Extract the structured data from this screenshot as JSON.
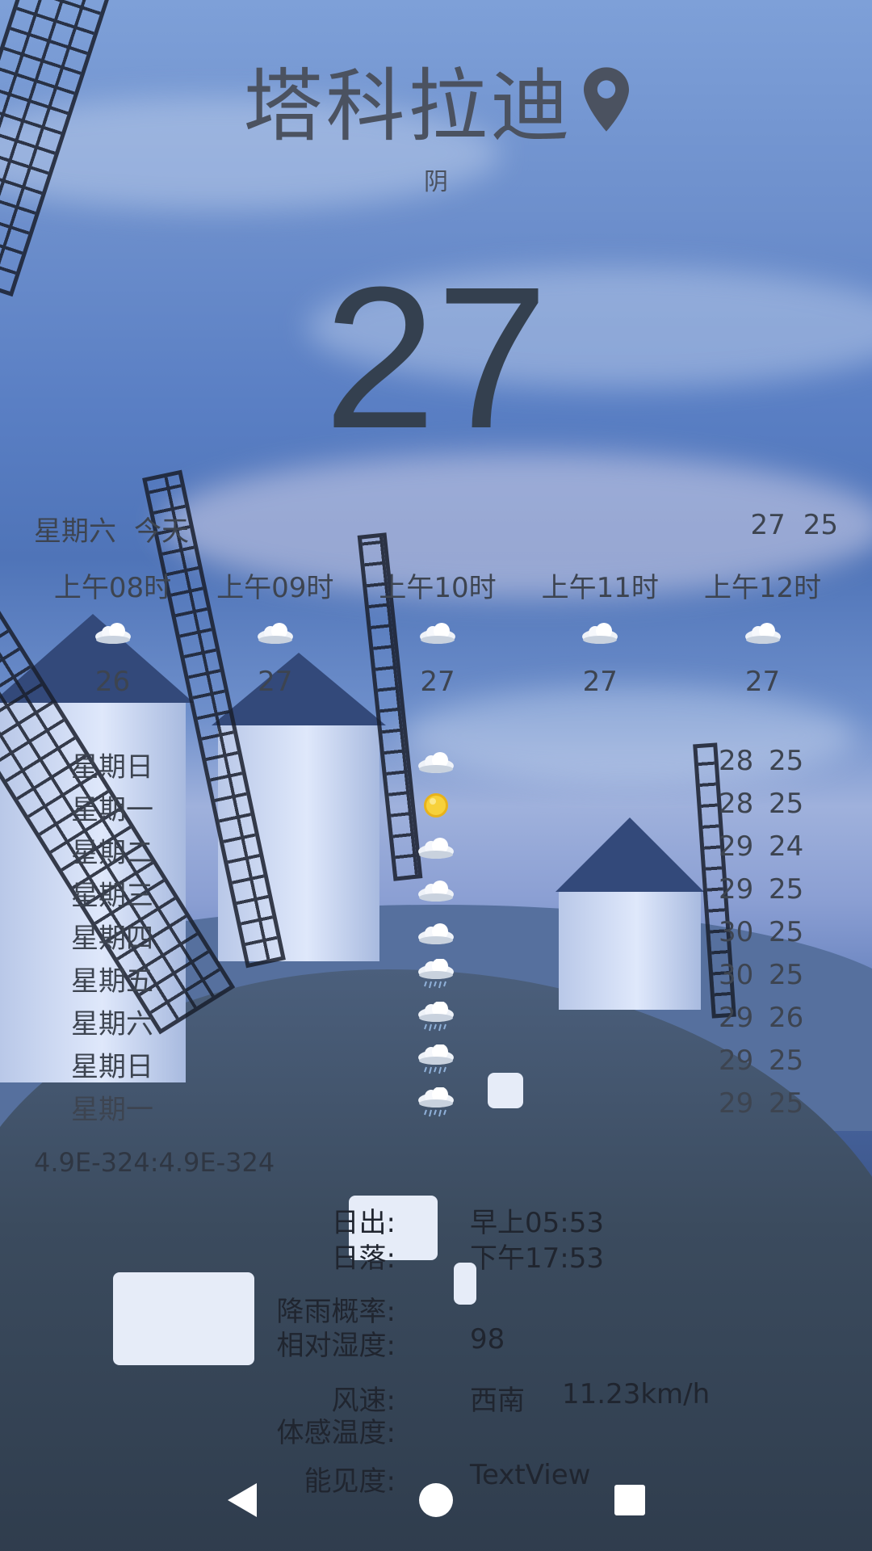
{
  "header": {
    "city": "塔科拉迪",
    "condition": "阴",
    "temperature": "27",
    "location_icon": "location-pin-icon"
  },
  "today": {
    "weekday": "星期六",
    "label": "今天",
    "high": "27",
    "low": "25"
  },
  "hourly": [
    {
      "time": "上午08时",
      "icon": "cloud-icon",
      "temp": "26"
    },
    {
      "time": "上午09时",
      "icon": "cloud-icon",
      "temp": "27"
    },
    {
      "time": "上午10时",
      "icon": "cloud-icon",
      "temp": "27"
    },
    {
      "time": "上午11时",
      "icon": "cloud-icon",
      "temp": "27"
    },
    {
      "time": "上午12时",
      "icon": "cloud-icon",
      "temp": "27"
    }
  ],
  "daily": [
    {
      "day": "星期日",
      "icon": "cloud-icon",
      "high": "28",
      "low": "25"
    },
    {
      "day": "星期一",
      "icon": "sun-icon",
      "high": "28",
      "low": "25"
    },
    {
      "day": "星期二",
      "icon": "cloud-icon",
      "high": "29",
      "low": "24"
    },
    {
      "day": "星期三",
      "icon": "cloud-icon",
      "high": "29",
      "low": "25"
    },
    {
      "day": "星期四",
      "icon": "cloud-icon",
      "high": "30",
      "low": "25"
    },
    {
      "day": "星期五",
      "icon": "rain-cloud-icon",
      "high": "30",
      "low": "25"
    },
    {
      "day": "星期六",
      "icon": "rain-cloud-icon",
      "high": "29",
      "low": "26"
    },
    {
      "day": "星期日",
      "icon": "rain-cloud-icon",
      "high": "29",
      "low": "25"
    },
    {
      "day": "星期一",
      "icon": "rain-cloud-icon",
      "high": "29",
      "low": "25"
    }
  ],
  "coordinates": "4.9E-324:4.9E-324",
  "details": {
    "sunrise_label": "日出:",
    "sunrise_value": "早上05:53",
    "sunset_label": "日落:",
    "sunset_value": "下午17:53",
    "rain_label": "降雨概率:",
    "rain_value": "",
    "humidity_label": "相对湿度:",
    "humidity_value": "98",
    "wind_label": "风速:",
    "wind_dir": "西南",
    "wind_speed": "11.23km/h",
    "feels_label": "体感温度:",
    "feels_value": "",
    "extra_label": "能见度:",
    "extra_value": "TextView"
  },
  "navbar": {
    "back_icon": "back-triangle-icon",
    "home_icon": "home-circle-icon",
    "recents_icon": "recents-square-icon"
  }
}
